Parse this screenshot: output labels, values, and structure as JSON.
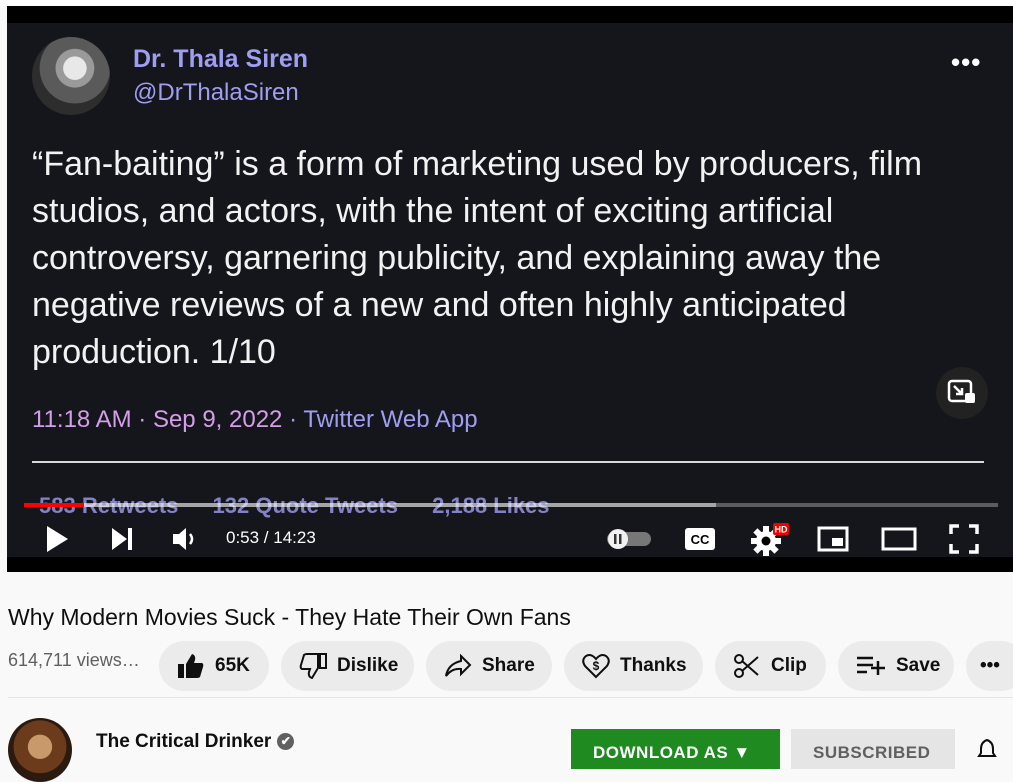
{
  "tweet": {
    "author_name": "Dr. Thala Siren",
    "handle": "@DrThalaSiren",
    "more_label": "•••",
    "body": "“Fan-baiting” is a form of marketing used by producers, film studios, and actors, with the intent of exciting artificial controversy, garnering publicity, and explaining away the negative reviews of a new and often highly anticipated production. 1/10",
    "time": "11:18 AM",
    "separator1": " · ",
    "date": "Sep 9, 2022",
    "separator2": " · ",
    "source": "Twitter Web App",
    "stats": [
      "583 Retweets",
      "132 Quote Tweets",
      "2,188 Likes"
    ]
  },
  "player": {
    "current_time": "0:53 / 14:23",
    "played_fraction": 0.0617,
    "loaded_fraction": 0.71,
    "hd_badge": "HD",
    "cc_label": "CC",
    "icons": [
      "play-icon",
      "next-icon",
      "volume-icon",
      "autoplay-toggle",
      "captions-icon",
      "settings-icon",
      "miniplayer-icon",
      "theater-icon",
      "fullscreen-icon",
      "exit-pip-icon"
    ]
  },
  "video": {
    "title": "Why Modern Movies Suck - They Hate Their Own Fans",
    "views": "614,711 views…"
  },
  "actions": {
    "like_count": "65K",
    "dislike_label": "Dislike",
    "share_label": "Share",
    "thanks_label": "Thanks",
    "clip_label": "Clip",
    "save_label": "Save",
    "more_label": "•••"
  },
  "channel": {
    "name": "The Critical Drinker",
    "verified_mark": "✔",
    "download_label": "DOWNLOAD AS ▼",
    "subscribe_label": "SUBSCRIBED"
  }
}
